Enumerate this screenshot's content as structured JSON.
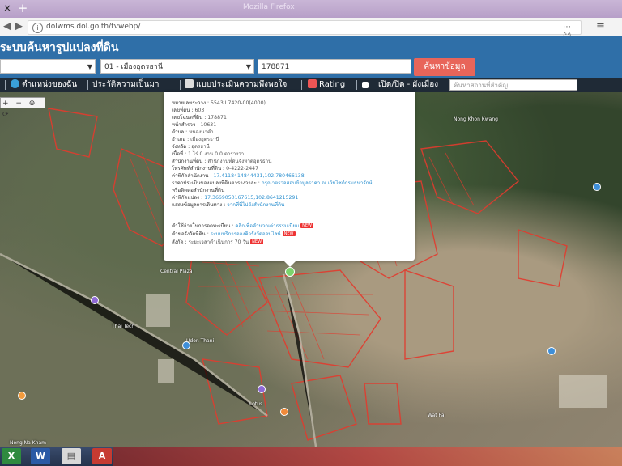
{
  "browser": {
    "tab_title": "Mozilla Firefox",
    "url": "dolwms.dol.go.th/tvwebp/",
    "close_glyph": "×",
    "add_glyph": "+"
  },
  "app": {
    "title": "ระบบค้นหารูปแปลงที่ดิน"
  },
  "search": {
    "province_value": "",
    "district_value": "01 - เมืองอุดรธานี",
    "parcel_value": "178871",
    "button_label": "ค้นหาข้อมูล"
  },
  "toolbar": {
    "item_location": "ตำแหน่งของฉัน",
    "item_history": "ประวัติความเป็นมา",
    "item_survey": "แบบประเมินความพึงพอใจ",
    "item_rating": "Rating",
    "item_toggle": "เปิด/ปิด - ผังเมือง",
    "place_search_placeholder": "ค้นหาสถานที่สำคัญ"
  },
  "popup": {
    "rows": [
      {
        "label": "หมายเลขระวาง :",
        "value": "5543 I 7420-00(4000)"
      },
      {
        "label": "เลขที่ดิน :",
        "value": "603"
      },
      {
        "label": "เลขโฉนดที่ดิน :",
        "value": "178871"
      },
      {
        "label": "หน้าสำรวจ :",
        "value": "10631"
      },
      {
        "label": "ตำบล :",
        "value": "หนองนาคำ"
      },
      {
        "label": "อำเภอ :",
        "value": "เมืองอุดรธานี"
      },
      {
        "label": "จังหวัด :",
        "value": "อุดรธานี"
      },
      {
        "label": "เนื้อที่ :",
        "value": "1 ไร่ 0 งาน 0.0 ตารางวา"
      },
      {
        "label": "สำนักงานที่ดิน :",
        "value": "สำนักงานที่ดินจังหวัดอุดรธานี"
      },
      {
        "label": "โทรศัพท์สำนักงานที่ดิน :",
        "value": "0-4222-2447"
      },
      {
        "label": "ค่าพิกัดสำนักงาน :",
        "value": "17.4118414844431,102.780466138"
      },
      {
        "label": "ราคาประเมินของแปลงที่ดินตารางวาละ :",
        "value": "กรุณาตรวจสอบข้อมูลราคา ณ เว็บไซต์กรมธนารักษ์"
      },
      {
        "label": "หรือติดต่อสำนักงานที่ดิน",
        "value": ""
      },
      {
        "label": "ค่าพิกัดแปลง :",
        "value": "17.3669050167615,102.8641215291"
      },
      {
        "label": "แสดงข้อมูลการเดินทาง :",
        "value": "จากที่นี่ไปยังสำนักงานที่ดิน"
      }
    ],
    "footer": [
      {
        "label": "คำใช้จ่ายในการจดทะเบียน :",
        "link": "คลิกเพื่อคำนวณค่าธรรมเนียม",
        "badge": "NEW"
      },
      {
        "label": "คำขอรังวัดที่ดิน :",
        "link": "ระบบบริการจองคิวรังวัดออนไลน์",
        "badge": "NEW"
      },
      {
        "label": "สังกัด :",
        "link": "ระยะเวลาดำเนินการ 70 วัน",
        "badge": "NEW"
      }
    ]
  },
  "map": {
    "labels": [
      "Central Plaza",
      "Udon Thani",
      "Thai Tech",
      "Lotus",
      "Wat Pa",
      "Nong Na Kham",
      "Nong Khon Kwang"
    ],
    "controls": "+ − ⊕ ⟳"
  },
  "taskbar": {
    "apps": [
      "Excel",
      "Word",
      "Files",
      "Acrobat"
    ]
  },
  "colors": {
    "header_blue": "#2f6fa8",
    "search_button": "#e8655a",
    "parcel_red": "#e23b2e",
    "pin_green": "#7bd36b"
  }
}
